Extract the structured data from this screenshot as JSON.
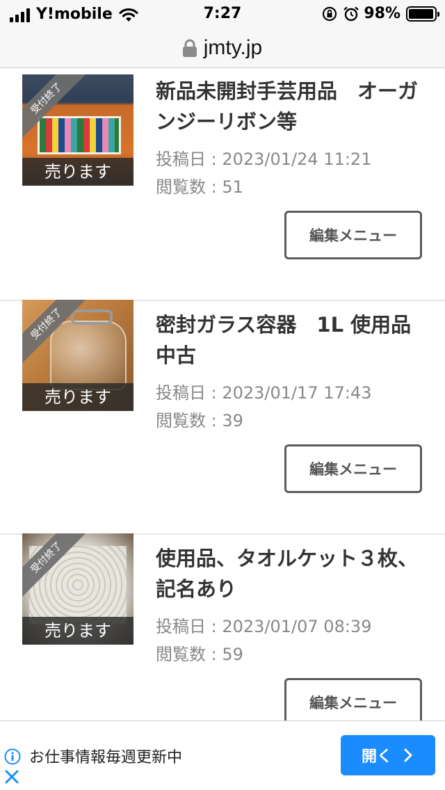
{
  "status_bar": {
    "carrier": "Y!mobile",
    "time": "7:27",
    "battery_percent": "98%",
    "battery_level": 0.98
  },
  "address_bar": {
    "url": "jmty.jp"
  },
  "listings": [
    {
      "title": "新品未開封手芸用品　オーガンジーリボン等",
      "posted": "投稿日 : 2023/01/24 11:21",
      "views": "閲覧数 : 51",
      "banner": "受付終了",
      "sell_label": "売ります",
      "edit_label": "編集メニュー"
    },
    {
      "title": "密封ガラス容器　1L 使用品　中古",
      "posted": "投稿日 : 2023/01/17 17:43",
      "views": "閲覧数 : 39",
      "banner": "受付終了",
      "sell_label": "売ります",
      "edit_label": "編集メニュー"
    },
    {
      "title": "使用品、タオルケット３枚、記名あり",
      "posted": "投稿日 : 2023/01/07 08:39",
      "views": "閲覧数 : 59",
      "banner": "受付終了",
      "sell_label": "売ります",
      "edit_label": "編集メニュー"
    }
  ],
  "ad": {
    "text": "お仕事情報毎週更新中",
    "button_label": "開く",
    "button_color": "#1a8cff"
  }
}
